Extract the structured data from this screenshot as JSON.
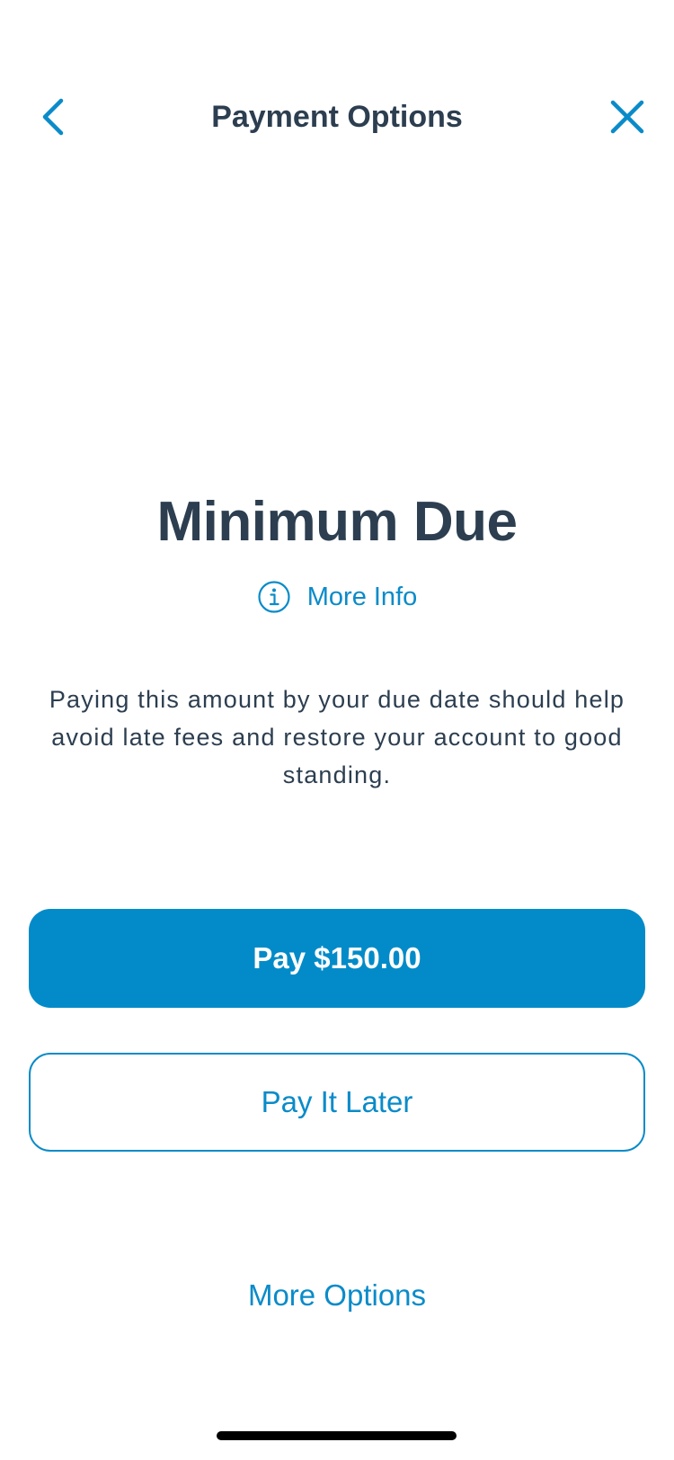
{
  "header": {
    "title": "Payment Options",
    "back_icon": "chevron-left-icon",
    "close_icon": "close-icon"
  },
  "main": {
    "heading": "Minimum Due",
    "more_info_label": "More Info",
    "more_info_icon": "info-circle-icon",
    "description": "Paying this amount by your due date should help avoid late fees and restore your account to good standing."
  },
  "actions": {
    "pay_label": "Pay $150.00",
    "later_label": "Pay It Later",
    "more_options_label": "More Options"
  },
  "colors": {
    "accent": "#0a8bc9",
    "primary_button": "#028bc8",
    "text": "#2c3e50"
  }
}
